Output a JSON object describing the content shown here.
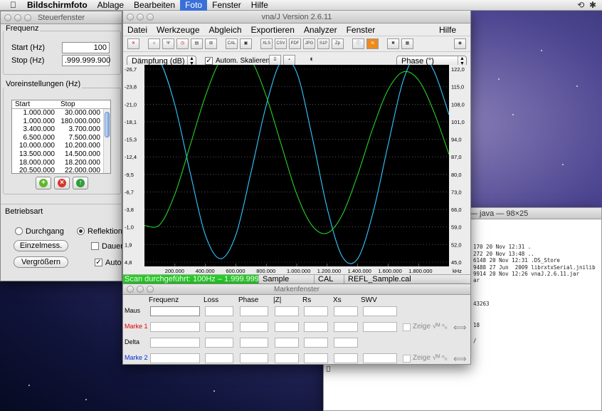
{
  "menubar": {
    "app": "Bildschirmfoto",
    "items": [
      "Ablage",
      "Bearbeiten",
      "Foto",
      "Fenster",
      "Hilfe"
    ],
    "active": "Foto"
  },
  "steuer": {
    "title": "Steuerfenster",
    "frequenz_label": "Frequenz",
    "start_label": "Start (Hz)",
    "start_value": "100",
    "stop_label": "Stop (Hz)",
    "stop_value": ".999.999.900",
    "voreinst_label": "Voreinstellungen (Hz)",
    "list_headers": [
      "Start",
      "Stop"
    ],
    "list_rows": [
      [
        "1.000.000",
        "30.000.000"
      ],
      [
        "1.000.000",
        "180.000.000"
      ],
      [
        "3.400.000",
        "3.700.000"
      ],
      [
        "6.500.000",
        "7.500.000"
      ],
      [
        "10.000.000",
        "10.200.000"
      ],
      [
        "13.500.000",
        "14.500.000"
      ],
      [
        "18.000.000",
        "18.200.000"
      ],
      [
        "20.500.000",
        "22.000.000"
      ]
    ],
    "betriebsart_label": "Betriebsart",
    "mode_durchgang": "Durchgang",
    "mode_reflektion": "Reflektion",
    "einzel": "Einzelmess.",
    "dauer": "Dauer",
    "vergroessern": "Vergrößern",
    "auto": "Auto"
  },
  "vna": {
    "title": "vna/J Version 2.6.11",
    "menu": [
      "Datei",
      "Werkzeuge",
      "Abgleich",
      "Exportieren",
      "Analyzer",
      "Fenster"
    ],
    "help": "Hilfe",
    "toolbar": [
      "CAL",
      "XLS",
      "CSV",
      "PDF",
      "JPG",
      "S1P",
      "Zp"
    ],
    "left_select": "Dämpfung (dB)",
    "autoscale": "Autom. Skalieren",
    "right_select": "Phase (°)",
    "status": {
      "scan": "Scan durchgeführt: 100Hz – 1.999.999...",
      "sample": "Sample",
      "cal": "CAL",
      "file": "REFL_Sample.cal"
    }
  },
  "chart_data": {
    "type": "line",
    "left_axis_label": "Dämpfung (dB)",
    "right_axis_label": "Phase (°)",
    "x_unit": "kHz",
    "xlim": [
      0,
      2000
    ],
    "x_ticks": [
      "200.000",
      "400.000",
      "600.000",
      "800.000",
      "1.000.000",
      "1.200.000",
      "1.400.000",
      "1.600.000",
      "1.800.000"
    ],
    "left_ticks": [
      "-26,7",
      "-23,8",
      "-21,0",
      "-18,1",
      "-15,3",
      "-12,4",
      "-9,5",
      "-6,7",
      "-3,8",
      "-1,0",
      "1,9",
      "4,8"
    ],
    "ylim_left": [
      4.8,
      -26.7
    ],
    "right_ticks": [
      "122,0",
      "115,0",
      "108,0",
      "101,0",
      "94,0",
      "87,0",
      "80,0",
      "73,0",
      "66,0",
      "59,0",
      "52,0",
      "45,0"
    ],
    "ylim_right": [
      45,
      122
    ],
    "series": [
      {
        "color": "#35c8ff",
        "x": [
          0,
          100,
          200,
          300,
          400,
          500,
          600,
          700,
          800,
          900,
          1000,
          1100,
          1200,
          1300,
          1400,
          1500,
          1600,
          1700,
          1800,
          1900,
          2000
        ],
        "values": [
          -28.4,
          -27.3,
          -20.4,
          -9.9,
          -0.1,
          3.6,
          -0.1,
          -9.9,
          -20.4,
          -27.3,
          -25.5,
          -15.6,
          -4.3,
          3.3,
          3.6,
          -3.5,
          -14.2,
          -24.3,
          -28.5,
          -25.8,
          -18.9
        ]
      },
      {
        "color": "#28d028",
        "x": [
          0,
          100,
          200,
          300,
          400,
          500,
          600,
          700,
          800,
          900,
          1000,
          1100,
          1200,
          1300,
          1400,
          1500,
          1600,
          1700,
          1800,
          1900,
          2000
        ],
        "values": [
          -1.6,
          -1.7,
          -6.5,
          -14.1,
          -21.8,
          -27.5,
          -29.5,
          -27.5,
          -21.8,
          -14.1,
          -6.5,
          -1.6,
          -0.4,
          -3.3,
          -9.5,
          -16.8,
          -22.8,
          -25.6,
          -24.3,
          -19.4,
          -12.7
        ]
      }
    ]
  },
  "marker": {
    "title": "Markenfenster",
    "headers": [
      "Frequenz",
      "Loss",
      "Phase",
      "|Z|",
      "Rs",
      "Xs",
      "SWV"
    ],
    "rows": [
      {
        "label": "Maus",
        "color": "#000000"
      },
      {
        "label": "Marke 1",
        "color": "#e00000"
      },
      {
        "label": "Delta",
        "color": "#000000"
      },
      {
        "label": "Marke 2",
        "color": "#0030d0"
      }
    ],
    "zeige": "Zeige"
  },
  "terminal": {
    "title": "— java — 98×25",
    "lines": [
      "170 20 Nov 12:31 .",
      "272 20 Nov 13:48 ..",
      "6148 20 Nov 12:31 .DS_Store",
      "9488 27 Jun  2009 librxtxSerial.jnilib",
      "9914 20 Nov 12:26 vnaJ.2.6.11.jar"
    ],
    "extra": [
      "ar",
      "43263",
      "18",
      "/"
    ]
  }
}
